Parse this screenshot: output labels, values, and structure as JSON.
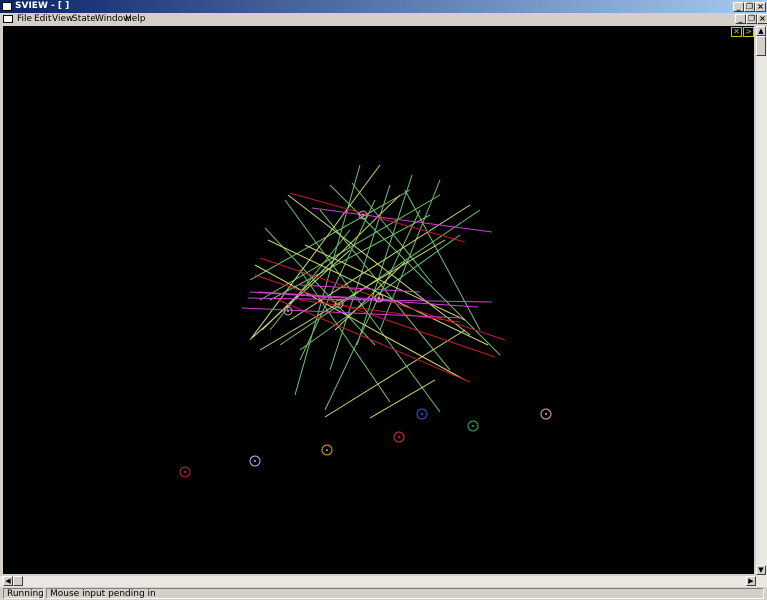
{
  "window": {
    "title": "SVIEW - [ ]"
  },
  "menu": [
    "File",
    "Edit",
    "View",
    "State",
    "Window",
    "Help"
  ],
  "status": {
    "state": "Running",
    "message": "Mouse input pending in"
  },
  "colors": {
    "canvas_bg": "#000000",
    "green": "#6fc070",
    "yellow_green": "#c8d870",
    "red": "#c81a2a",
    "magenta": "#d040d0"
  },
  "icons": {
    "close": "×",
    "restore": "❐",
    "minimize": "_",
    "nav_left": "✕",
    "nav_right": ">"
  }
}
